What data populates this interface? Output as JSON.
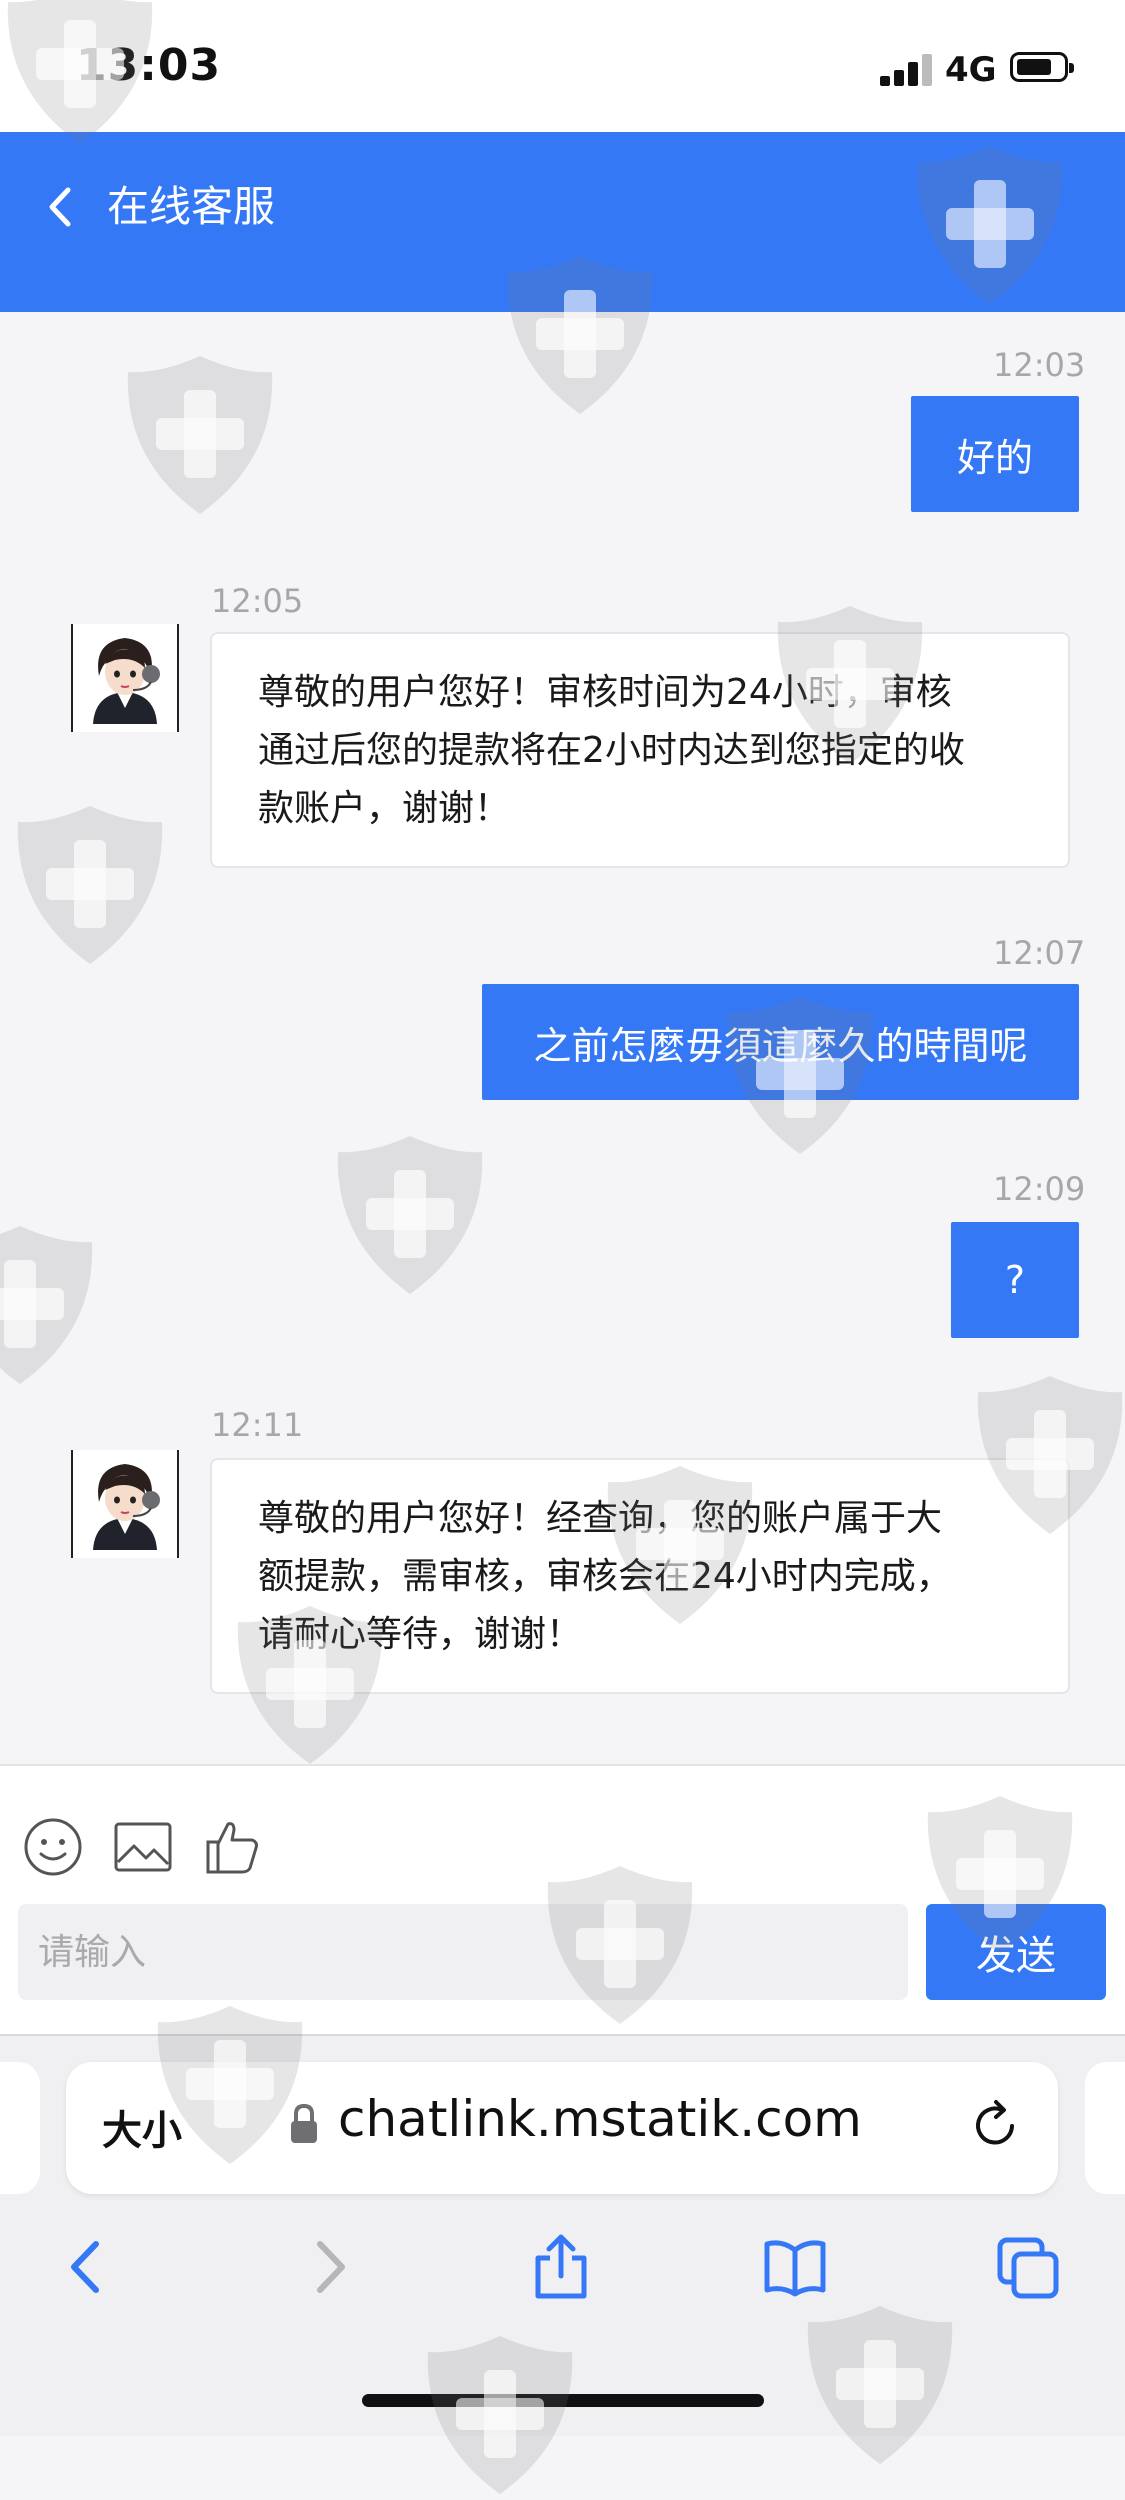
{
  "status_bar": {
    "time": "13:03",
    "network": "4G"
  },
  "header": {
    "title": "在线客服"
  },
  "messages": [
    {
      "time": "12:03",
      "from": "user",
      "lines": [
        "好的"
      ]
    },
    {
      "time": "12:05",
      "from": "agent",
      "lines": [
        "尊敬的用户您好！审核时间为24小时，审核",
        "通过后您的提款将在2小时内达到您指定的收",
        "款账户，谢谢！"
      ]
    },
    {
      "time": "12:07",
      "from": "user",
      "lines": [
        "之前怎麼毋須這麼久的時間呢"
      ]
    },
    {
      "time": "12:09",
      "from": "user",
      "lines": [
        "?"
      ]
    },
    {
      "time": "12:11",
      "from": "agent",
      "lines": [
        "尊敬的用户您好！经查询，您的账户属于大",
        "额提款，需审核，审核会在24小时内完成，",
        "请耐心等待，谢谢！"
      ]
    }
  ],
  "composer": {
    "placeholder": "请输入",
    "send_label": "发送"
  },
  "browser": {
    "text_size_label": "大小",
    "url": "chatlink.mstatik.com"
  },
  "colors": {
    "accent": "#3478f6",
    "background": "#f5f5f7",
    "timestamp": "#a6a6ab"
  },
  "icons": [
    "back-icon",
    "emoji-icon",
    "image-icon",
    "thumbs-up-icon",
    "lock-icon",
    "reload-icon",
    "browser-back-icon",
    "browser-forward-icon",
    "share-icon",
    "bookmarks-icon",
    "tabs-icon"
  ]
}
